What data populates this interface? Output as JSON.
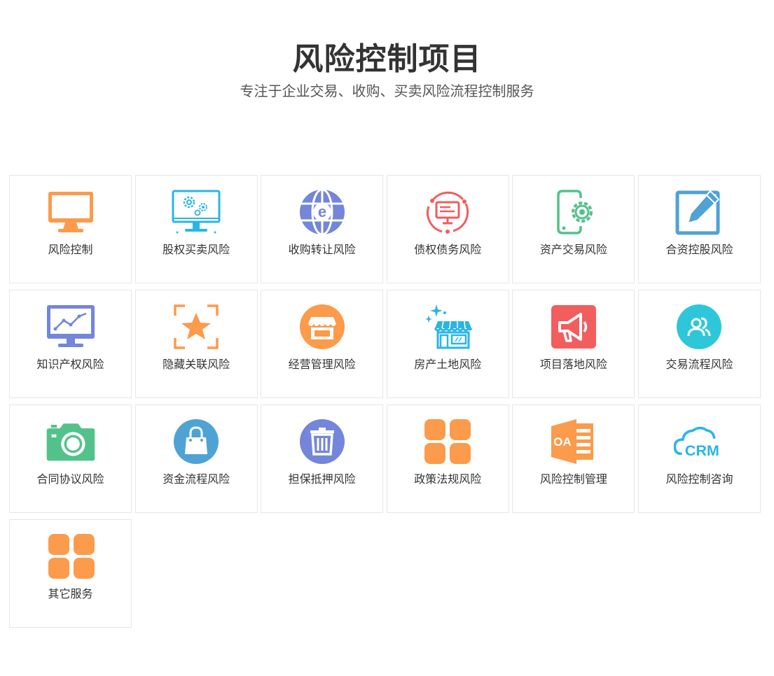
{
  "header": {
    "title": "风险控制项目",
    "subtitle": "专注于企业交易、收购、买卖风险流程控制服务"
  },
  "colors": {
    "orange": "#fb9b4b",
    "cyan": "#29b6e6",
    "blue_violet": "#7486d9",
    "red": "#f25d5d",
    "green": "#52c28a",
    "steel_blue": "#4ea3d4",
    "teal": "#2ec7d9"
  },
  "services": [
    {
      "label": "风险控制",
      "icon": "monitor-icon"
    },
    {
      "label": "股权买卖风险",
      "icon": "gear-screen-icon"
    },
    {
      "label": "收购转让风险",
      "icon": "globe-e-icon"
    },
    {
      "label": "债权债务风险",
      "icon": "presentation-cycle-icon"
    },
    {
      "label": "资产交易风险",
      "icon": "tablet-gear-icon"
    },
    {
      "label": "合资控股风险",
      "icon": "edit-pencil-icon"
    },
    {
      "label": "知识产权风险",
      "icon": "chart-monitor-icon"
    },
    {
      "label": "隐藏关联风险",
      "icon": "star-frame-icon"
    },
    {
      "label": "经营管理风险",
      "icon": "shop-circle-icon"
    },
    {
      "label": "房产土地风险",
      "icon": "storefront-sparkle-icon"
    },
    {
      "label": "项目落地风险",
      "icon": "megaphone-icon"
    },
    {
      "label": "交易流程风险",
      "icon": "users-circle-icon"
    },
    {
      "label": "合同协议风险",
      "icon": "camera-icon"
    },
    {
      "label": "资金流程风险",
      "icon": "shopping-bag-icon"
    },
    {
      "label": "担保抵押风险",
      "icon": "trash-icon"
    },
    {
      "label": "政策法规风险",
      "icon": "grid-squares-icon"
    },
    {
      "label": "风险控制管理",
      "icon": "oa-icon",
      "icon_text": "OA"
    },
    {
      "label": "风险控制咨询",
      "icon": "crm-cloud-icon",
      "icon_text": "CRM"
    },
    {
      "label": "其它服务",
      "icon": "grid-squares-icon"
    }
  ]
}
